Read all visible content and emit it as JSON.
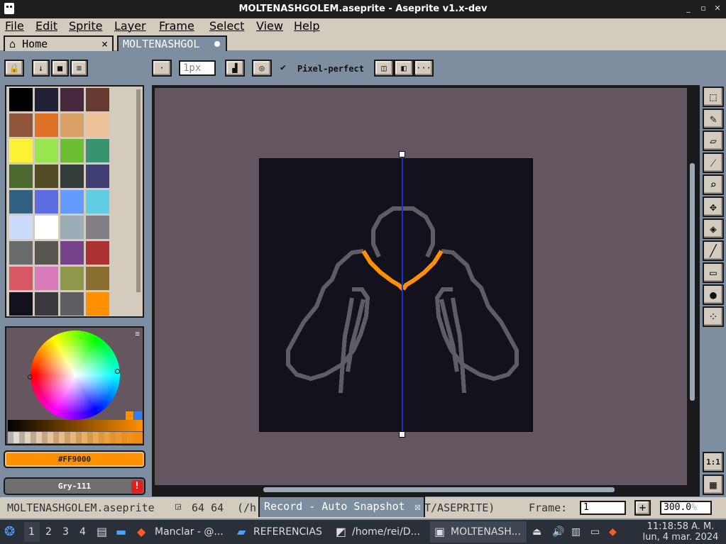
{
  "window": {
    "title": "MOLTENASHGOLEM.aseprite - Aseprite v1.x-dev",
    "controls": [
      "_",
      "▫",
      "✕"
    ]
  },
  "menu": [
    "File",
    "Edit",
    "Sprite",
    "Layer",
    "Frame",
    "Select",
    "View",
    "Help"
  ],
  "tabs": {
    "home": "Home",
    "home_close": "×",
    "document": "MOLTENASHGOL"
  },
  "context_bar": {
    "brush_size": "1px",
    "pixel_perfect_label": "Pixel-perfect",
    "more": "···"
  },
  "palette": {
    "colors": [
      "#000000",
      "#222034",
      "#45283c",
      "#663931",
      "#8f563b",
      "#df7126",
      "#d9a066",
      "#eec39a",
      "#fbf236",
      "#99e550",
      "#6abe30",
      "#37946e",
      "#4b692f",
      "#524b24",
      "#323c39",
      "#3f3f74",
      "#306082",
      "#5b6ee1",
      "#639bff",
      "#5fcde4",
      "#cbdbfc",
      "#ffffff",
      "#9badb7",
      "#847e87",
      "#696a6a",
      "#595652",
      "#76428a",
      "#ac3232",
      "#d95763",
      "#d77bba",
      "#8f974a",
      "#8a6f30",
      "#13111c",
      "#3a393d",
      "#5f5f63",
      "#ff9000"
    ]
  },
  "colors": {
    "foreground_label": "#FF9000",
    "foreground_hex": "#ff9000",
    "background_label": "Gry-111",
    "background_hex": "#6f6f6f",
    "warning": "!"
  },
  "canvas": {
    "symmetry_axis": "vertical",
    "background": "#645660",
    "sprite_bg": "#13111c"
  },
  "tools": [
    "selection",
    "pencil",
    "eraser",
    "eyedropper",
    "zoom",
    "move",
    "paint-bucket",
    "line",
    "rectangle",
    "blur",
    "spray"
  ],
  "zoom_buttons": {
    "one_to_one": "1:1"
  },
  "status": {
    "filename": "MOLTENASHGOLEM.aseprite",
    "size": "64 64",
    "path_prefix": "(/h",
    "path_suffix": "T/ASEPRITE)",
    "frame_label": "Frame:",
    "frame_value": "1",
    "zoom_value": "300.0",
    "zoom_unit": "%"
  },
  "record_popup": {
    "text": "Record - Auto Snapshot",
    "close": "☒"
  },
  "taskbar": {
    "workspaces": [
      "1",
      "2",
      "3",
      "4"
    ],
    "apps": [
      {
        "label": "Manclar - @..."
      },
      {
        "label": "REFERENCIAS"
      },
      {
        "label": "/home/rei/D..."
      },
      {
        "label": "MOLTENASH..."
      }
    ],
    "time": "11:18:58 A. M.",
    "date": "lun, 4 mar. 2024"
  }
}
